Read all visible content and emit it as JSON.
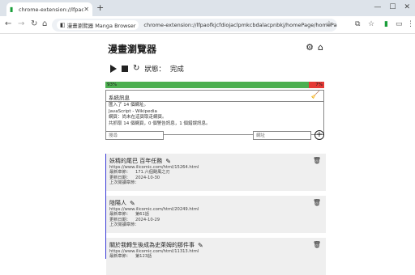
{
  "browser": {
    "tab_title": "chrome-extension://lfpaofkj",
    "site_chip": "漫畫瀏覽器 Manga Browser",
    "url": "chrome-extension://lfpaofkjcfdiojaclpmkcbdalacpnbkj/homePage/homePage.html"
  },
  "app": {
    "title": "漫畫瀏覽器",
    "status_label": "狀態：",
    "status_value": "完成"
  },
  "progress": {
    "left_text": "93%",
    "right_text": "7%",
    "fraction": 0.93
  },
  "system": {
    "heading": "系統訊息",
    "lines": [
      "匯入了 14 個網址。",
      "JavaScript - Wikipedia",
      "網頁：尚未在這頁取走網頁。",
      "共抓取 14 個網頁，0 個警告訊息，1 個錯誤訊息。"
    ]
  },
  "inputs": {
    "search_placeholder": "搜尋",
    "url_placeholder": "網址"
  },
  "cards": [
    {
      "title": "妖精的尾巴 百年任務",
      "url": "https://www.ilicomic.com/html/15264.html",
      "latest_label": "最新章節：",
      "latest_value": "171.六個颶風之刃",
      "updated_label": "更新日期：",
      "updated_value": "2024-10-30",
      "last_read_label": "上次閱讀章節："
    },
    {
      "title": "陰陽人",
      "url": "https://www.ilicomic.com/html/20249.html",
      "latest_label": "最新章節：",
      "latest_value": "第61話",
      "updated_label": "更新日期：",
      "updated_value": "2024-10-29",
      "last_read_label": "上次閱讀章節："
    },
    {
      "title": "關於我轉生後成為史萊姆的那件事",
      "url": "https://www.ilicomic.com/html/11313.html",
      "latest_label": "最新章節：",
      "latest_value": "第123話"
    }
  ]
}
